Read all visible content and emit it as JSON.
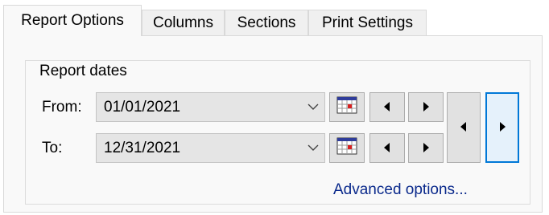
{
  "tabs": [
    {
      "label": "Report Options",
      "active": true
    },
    {
      "label": "Columns",
      "active": false
    },
    {
      "label": "Sections",
      "active": false
    },
    {
      "label": "Print Settings",
      "active": false
    }
  ],
  "group": {
    "title": "Report dates",
    "from_label": "From:",
    "from_value": "01/01/2021",
    "to_label": "To:",
    "to_value": "12/31/2021"
  },
  "advanced_link": "Advanced options...",
  "icons": {
    "calendar": "calendar-icon",
    "prev": "triangle-left-icon",
    "next": "triangle-right-icon",
    "dropdown": "chevron-down-icon"
  },
  "colors": {
    "link": "#0b2a8c",
    "focus": "#0078d7"
  }
}
